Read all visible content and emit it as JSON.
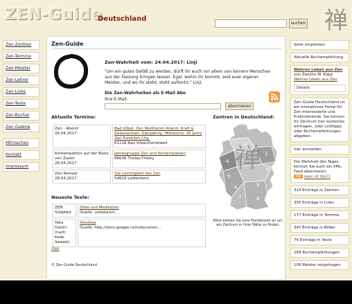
{
  "header": {
    "logo": "ZEN-Guide",
    "subtitle": "Deutschland",
    "search_button": "suchen",
    "kanji": "禅"
  },
  "leftnav": {
    "items": [
      "Zen-Zentren",
      "Zen-Termine",
      "Zen-Meister",
      "Zen-Lehrer",
      "Zen-Links",
      "Zen-Texte",
      "Zen-Bücher",
      "Zen-Galerie"
    ],
    "items2": [
      "Mitmachen",
      "Kontakt",
      "Impressum"
    ]
  },
  "main": {
    "title": "Zen-Guide",
    "quote_title": "Zen-Wahrheit vom: 24.04.2017: Linji",
    "quote_text": "\"Um ein gutes Gefäß zu werden, dürft ihr euch vor allem von keinem Menschen aus der Fassung bringen lassen. Egal, wohin ihr kommt, seid euer eigener Meister, und wo ihr steht, steht aufrecht.\" Linji",
    "abo_title": "Die Zen-Wahrheiten als E-Mail Abo",
    "abo_label": "Ihre E-Mail:",
    "abo_button": "abonnieren",
    "termine_title": "Aktuelle Termine:",
    "termine": [
      {
        "left1": "Zen - Abend",
        "left2": "26.04.2017",
        "link": "Bad Vilbel: Zen Meditation Abend, Kraft & Gelassenheit, Ganzjährig, Mittwochs, 20 Jahre Zen Frankfurt City.",
        "place": "61118 Bad Vilbel/Dortelweil"
      },
      {
        "left1": "Kontemplation auf der Basis von Zazen",
        "left2": "26.04.2017",
        "link": "Jahresgruppe Zen und Kontemplation",
        "place": "66636 Tholey-Theley"
      },
      {
        "left1": "Zen-Retreat",
        "left2": "28.04.2017",
        "link": "Die Leichtigkeit des Zen",
        "place": "54619 Leidenborn"
      }
    ],
    "texte_title": "Neueste Texte:",
    "texte": [
      {
        "left": "ZEN Südpfalz",
        "link": "Stille und Meditation",
        "source": "Quelle: unbekannt..."
      },
      {
        "left": "Yoka Daishi (nach Kodo Sawaki)",
        "link": "Shodoka",
        "source": "Quelle: http://docs.google.com/documen..."
      }
    ],
    "zen_link": "Zen",
    "copyright": "© Zen-Guide Deutschland",
    "map_title": "Zentren in Deutschland:",
    "map_caption": "Bitte klicken Sie eine Postleitzahl an um ein Zentrum in Ihrer Nähe zu finden.",
    "map_numbers": [
      "2",
      "1",
      "3",
      "4",
      "5",
      "6",
      "7",
      "8",
      "9",
      "0"
    ]
  },
  "right": {
    "item1": "Seite empfehlen",
    "item2": "Aktuelle Buchempfehlung",
    "book_title": "Wahres Leben aus Zen",
    "book_by": "von Zensho W. Kopp",
    "book_link": "Wahres Leben aus Zen",
    "details": "Details",
    "about": "Zen-Guide Deutschland ist ein interaktives Portal für Zen-Interessierte und Praktizierende. Sie können Ihr Zentrum hier kostenlos eintragen, oder Linktipps oder Buchempfehlungen abgeben.",
    "login": "hier anmelden",
    "feed_text": "Die Wahrheit des Tages, können Sie auch als XML-Feed abonnieren:",
    "feed_badge": "RSS",
    "feed_link": "(was ist das?)",
    "stats": [
      "314 Einträge in Zentren",
      "355 Einträge in Links",
      "177 Einträge in Termine",
      "347 Einträge in Bilder",
      "74 Einträge in Texte",
      "269 Buchempfehlungen",
      "109 Meister eingetragen"
    ]
  }
}
